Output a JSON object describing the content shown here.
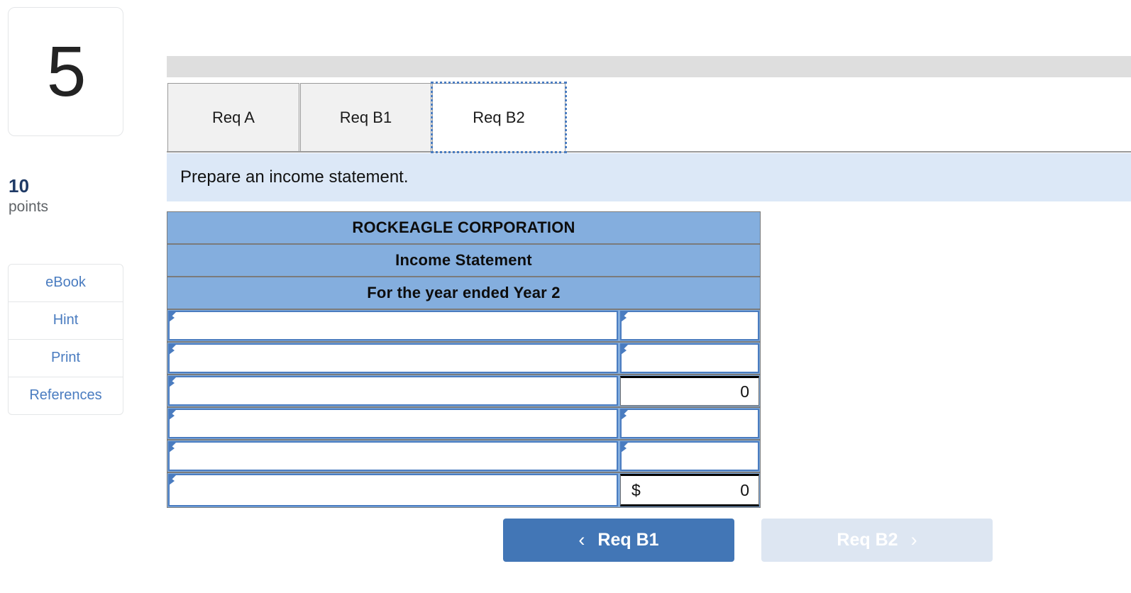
{
  "sidebar": {
    "question_number": "5",
    "points_value": "10",
    "points_label": "points",
    "tools": [
      {
        "label": "eBook",
        "name": "ebook"
      },
      {
        "label": "Hint",
        "name": "hint"
      },
      {
        "label": "Print",
        "name": "print"
      },
      {
        "label": "References",
        "name": "references"
      }
    ]
  },
  "tabs": [
    {
      "label": "Req A",
      "active": false
    },
    {
      "label": "Req B1",
      "active": false
    },
    {
      "label": "Req B2",
      "active": true
    }
  ],
  "instruction": "Prepare an income statement.",
  "statement": {
    "title": "ROCKEAGLE CORPORATION",
    "subtitle": "Income Statement",
    "period": "For the year ended Year 2",
    "rows": [
      {
        "label": "",
        "label_dropdown": true,
        "value": "",
        "value_dropdown": true,
        "currency": "",
        "style": "normal"
      },
      {
        "label": "",
        "label_dropdown": true,
        "value": "",
        "value_dropdown": true,
        "currency": "",
        "style": "normal"
      },
      {
        "label": "",
        "label_dropdown": true,
        "value": "0",
        "value_dropdown": false,
        "currency": "",
        "style": "total"
      },
      {
        "label": "",
        "label_dropdown": true,
        "value": "",
        "value_dropdown": true,
        "currency": "",
        "style": "normal"
      },
      {
        "label": "",
        "label_dropdown": true,
        "value": "",
        "value_dropdown": true,
        "currency": "",
        "style": "normal"
      },
      {
        "label": "",
        "label_dropdown": true,
        "value": "0",
        "value_dropdown": false,
        "currency": "$",
        "style": "grand"
      }
    ]
  },
  "navigation": {
    "prev_label": "Req B1",
    "prev_chevron": "chevron-left",
    "prev_glyph": "‹",
    "next_label": "Req B2",
    "next_chevron": "chevron-right",
    "next_glyph": "›"
  },
  "colors": {
    "accent_blue": "#4276b6",
    "header_blue": "#84aede",
    "banner_blue": "#dce8f7",
    "gray_bar": "#dedede",
    "disabled_blue": "#dde6f2",
    "link_blue": "#4a7cc0",
    "points_navy": "#1f3a66"
  }
}
